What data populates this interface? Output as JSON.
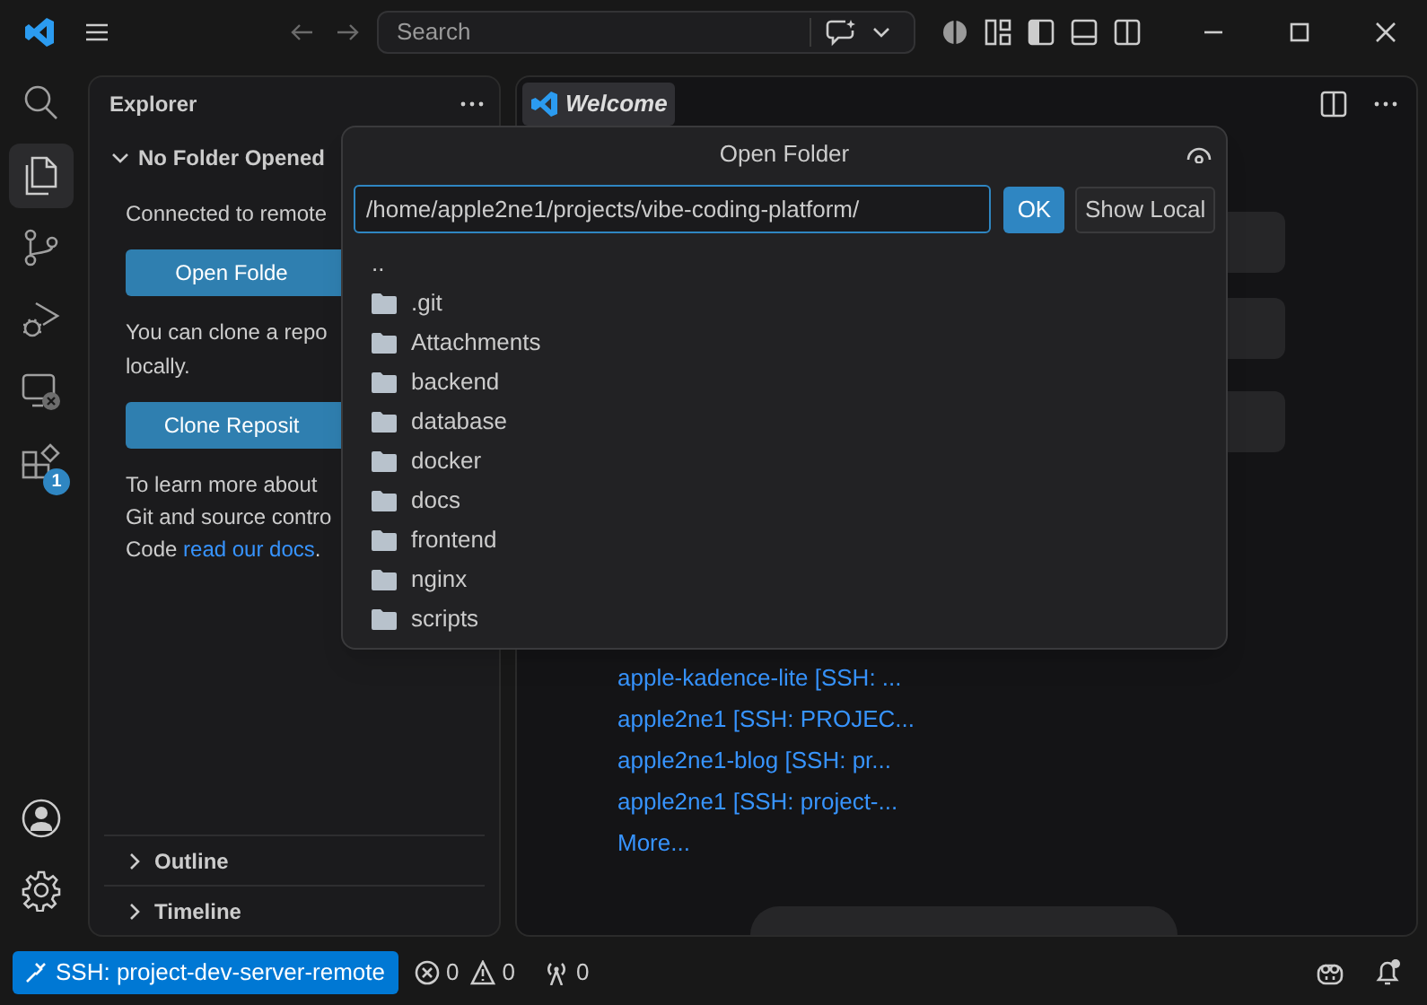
{
  "title_bar": {
    "search_placeholder": "Search"
  },
  "activity_bar": {
    "items": [
      {
        "kind": "search",
        "selected": false
      },
      {
        "kind": "explorer",
        "selected": true
      },
      {
        "kind": "source-control",
        "selected": false
      },
      {
        "kind": "run-debug",
        "selected": false
      },
      {
        "kind": "remote",
        "selected": false
      },
      {
        "kind": "extensions",
        "selected": false,
        "badge": "1"
      }
    ],
    "bottom_items": [
      {
        "kind": "account"
      },
      {
        "kind": "settings"
      }
    ]
  },
  "sidebar": {
    "title": "Explorer",
    "section": {
      "label": "No Folder Opened",
      "expanded": true
    },
    "content": [
      {
        "kind": "text",
        "text": "Connected to remote"
      },
      {
        "kind": "button",
        "text": "Open Folde"
      },
      {
        "kind": "text",
        "text": "You can clone a repo\nlocally."
      },
      {
        "kind": "button",
        "text": "Clone Reposit"
      },
      {
        "kind": "link_text",
        "text": "To learn more about\nGit and source contro\nCode ",
        "link": "read our docs",
        "after": "."
      }
    ],
    "footer_sections": [
      {
        "label": "Outline",
        "expanded": false
      },
      {
        "label": "Timeline",
        "expanded": false
      }
    ]
  },
  "editor": {
    "tabs": [
      {
        "label": "Welcome",
        "selected": true
      }
    ],
    "recent": [
      "apple-kadence-lite [SSH: ...",
      "apple2ne1 [SSH: PROJEC...",
      "apple2ne1-blog [SSH: pr...",
      "apple2ne1 [SSH: project-..."
    ],
    "more": "More..."
  },
  "dialog": {
    "title": "Open Folder",
    "path": "/home/apple2ne1/projects/vibe-coding-platform/",
    "buttons": [
      {
        "label": "OK",
        "kind": "primary"
      },
      {
        "label": "Show Local",
        "kind": "secondary"
      }
    ],
    "items": [
      {
        "label": "..",
        "kind": "parent"
      },
      {
        "label": ".git",
        "kind": "folder"
      },
      {
        "label": "Attachments",
        "kind": "folder"
      },
      {
        "label": "backend",
        "kind": "folder"
      },
      {
        "label": "database",
        "kind": "folder"
      },
      {
        "label": "docker",
        "kind": "folder"
      },
      {
        "label": "docs",
        "kind": "folder"
      },
      {
        "label": "frontend",
        "kind": "folder"
      },
      {
        "label": "nginx",
        "kind": "folder"
      },
      {
        "label": "scripts",
        "kind": "folder"
      }
    ]
  },
  "status_bar": {
    "remote": "SSH: project-dev-server-remote",
    "errors": "0",
    "warnings": "0",
    "ports": "0"
  }
}
